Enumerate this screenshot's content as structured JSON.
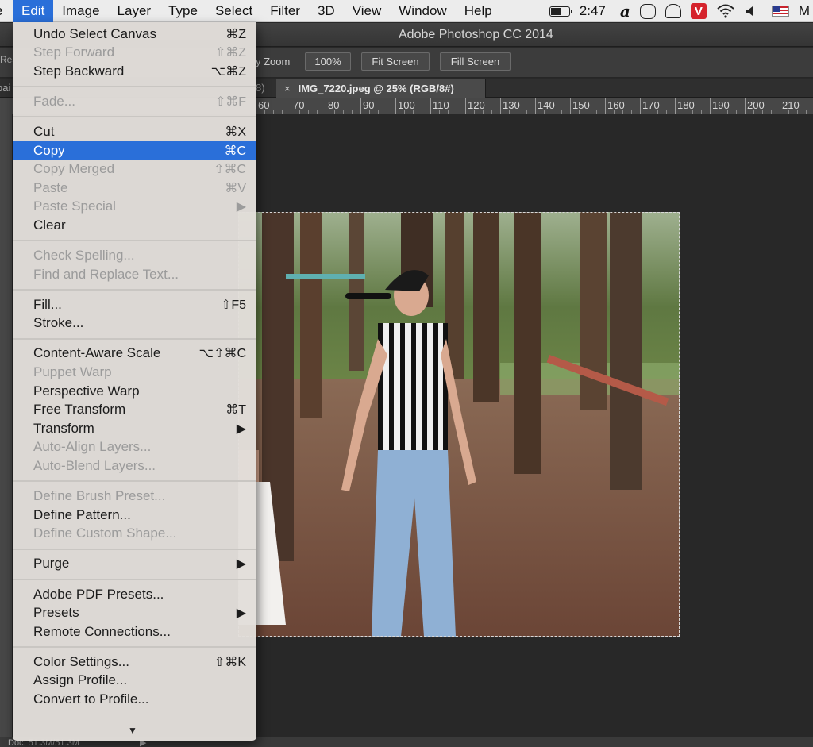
{
  "menubar": {
    "items": [
      {
        "label": "e"
      },
      {
        "label": "Edit"
      },
      {
        "label": "Image"
      },
      {
        "label": "Layer"
      },
      {
        "label": "Type"
      },
      {
        "label": "Select"
      },
      {
        "label": "Filter"
      },
      {
        "label": "3D"
      },
      {
        "label": "View"
      },
      {
        "label": "Window"
      },
      {
        "label": "Help"
      }
    ],
    "clock": "2:47",
    "alpha_glyph": "a",
    "v_badge": "V",
    "right_edge": "M"
  },
  "window": {
    "title": "Adobe Photoshop CC 2014"
  },
  "options_bar": {
    "left_peek": "Res",
    "label": "y Zoom",
    "buttons": [
      "100%",
      "Fit Screen",
      "Fill Screen"
    ]
  },
  "tabs": {
    "left_peek": "pai",
    "prev_tail": "8)",
    "close_glyph": "×",
    "active_title": "IMG_7220.jpeg @ 25% (RGB/8#)"
  },
  "ruler": {
    "labels": [
      "60",
      "70",
      "80",
      "90",
      "100",
      "110",
      "120",
      "130",
      "140",
      "150",
      "160",
      "170",
      "180",
      "190",
      "200",
      "210"
    ]
  },
  "edit_menu": {
    "groups": [
      [
        {
          "label": "Undo Select Canvas",
          "shortcut": "⌘Z",
          "enabled": true
        },
        {
          "label": "Step Forward",
          "shortcut": "⇧⌘Z",
          "enabled": false
        },
        {
          "label": "Step Backward",
          "shortcut": "⌥⌘Z",
          "enabled": true
        }
      ],
      [
        {
          "label": "Fade...",
          "shortcut": "⇧⌘F",
          "enabled": false
        }
      ],
      [
        {
          "label": "Cut",
          "shortcut": "⌘X",
          "enabled": true
        },
        {
          "label": "Copy",
          "shortcut": "⌘C",
          "enabled": true,
          "highlighted": true
        },
        {
          "label": "Copy Merged",
          "shortcut": "⇧⌘C",
          "enabled": false
        },
        {
          "label": "Paste",
          "shortcut": "⌘V",
          "enabled": false
        },
        {
          "label": "Paste Special",
          "shortcut": "▶",
          "enabled": false
        },
        {
          "label": "Clear",
          "shortcut": "",
          "enabled": true
        }
      ],
      [
        {
          "label": "Check Spelling...",
          "shortcut": "",
          "enabled": false
        },
        {
          "label": "Find and Replace Text...",
          "shortcut": "",
          "enabled": false
        }
      ],
      [
        {
          "label": "Fill...",
          "shortcut": "⇧F5",
          "enabled": true
        },
        {
          "label": "Stroke...",
          "shortcut": "",
          "enabled": true
        }
      ],
      [
        {
          "label": "Content-Aware Scale",
          "shortcut": "⌥⇧⌘C",
          "enabled": true
        },
        {
          "label": "Puppet Warp",
          "shortcut": "",
          "enabled": false
        },
        {
          "label": "Perspective Warp",
          "shortcut": "",
          "enabled": true
        },
        {
          "label": "Free Transform",
          "shortcut": "⌘T",
          "enabled": true
        },
        {
          "label": "Transform",
          "shortcut": "▶",
          "enabled": true
        },
        {
          "label": "Auto-Align Layers...",
          "shortcut": "",
          "enabled": false
        },
        {
          "label": "Auto-Blend Layers...",
          "shortcut": "",
          "enabled": false
        }
      ],
      [
        {
          "label": "Define Brush Preset...",
          "shortcut": "",
          "enabled": false
        },
        {
          "label": "Define Pattern...",
          "shortcut": "",
          "enabled": true
        },
        {
          "label": "Define Custom Shape...",
          "shortcut": "",
          "enabled": false
        }
      ],
      [
        {
          "label": "Purge",
          "shortcut": "▶",
          "enabled": true
        }
      ],
      [
        {
          "label": "Adobe PDF Presets...",
          "shortcut": "",
          "enabled": true
        },
        {
          "label": "Presets",
          "shortcut": "▶",
          "enabled": true
        },
        {
          "label": "Remote Connections...",
          "shortcut": "",
          "enabled": true
        }
      ],
      [
        {
          "label": "Color Settings...",
          "shortcut": "⇧⌘K",
          "enabled": true
        },
        {
          "label": "Assign Profile...",
          "shortcut": "",
          "enabled": true
        },
        {
          "label": "Convert to Profile...",
          "shortcut": "",
          "enabled": true
        }
      ]
    ],
    "more_glyph": "▼"
  },
  "status": {
    "doc": "Doc: 51.3M/51.3M",
    "arrow": "▶"
  },
  "colors": {
    "accent": "#2a6fd9",
    "menu_bg": "#e2deda",
    "ps_bg": "#282828"
  }
}
